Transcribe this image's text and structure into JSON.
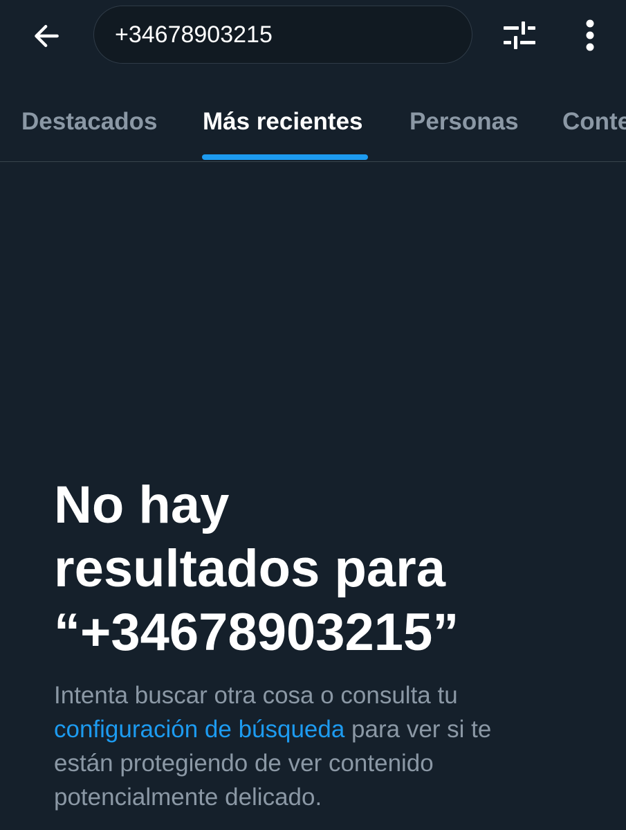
{
  "search": {
    "query": "+34678903215"
  },
  "tabs": [
    {
      "label": "Destacados",
      "active": false
    },
    {
      "label": "Más recientes",
      "active": true
    },
    {
      "label": "Personas",
      "active": false
    },
    {
      "label": "Contenido multimedia",
      "active": false
    }
  ],
  "empty_state": {
    "title_line1": "No hay",
    "title_line2": "resultados para",
    "title_line3": "“+34678903215”",
    "message_before_link": "Intenta buscar otra cosa o consulta tu ",
    "link_text": "configuración de búsqueda",
    "message_after_link": " para ver si te están protegiendo de ver contenido potencialmente delicado."
  },
  "icons": {
    "back": "arrow-left-icon",
    "filter": "sliders-icon",
    "more": "more-vertical-icon"
  },
  "colors": {
    "background": "#15202b",
    "accent": "#1d9bf0",
    "secondary_text": "#8b98a5",
    "divider": "#38444d"
  }
}
